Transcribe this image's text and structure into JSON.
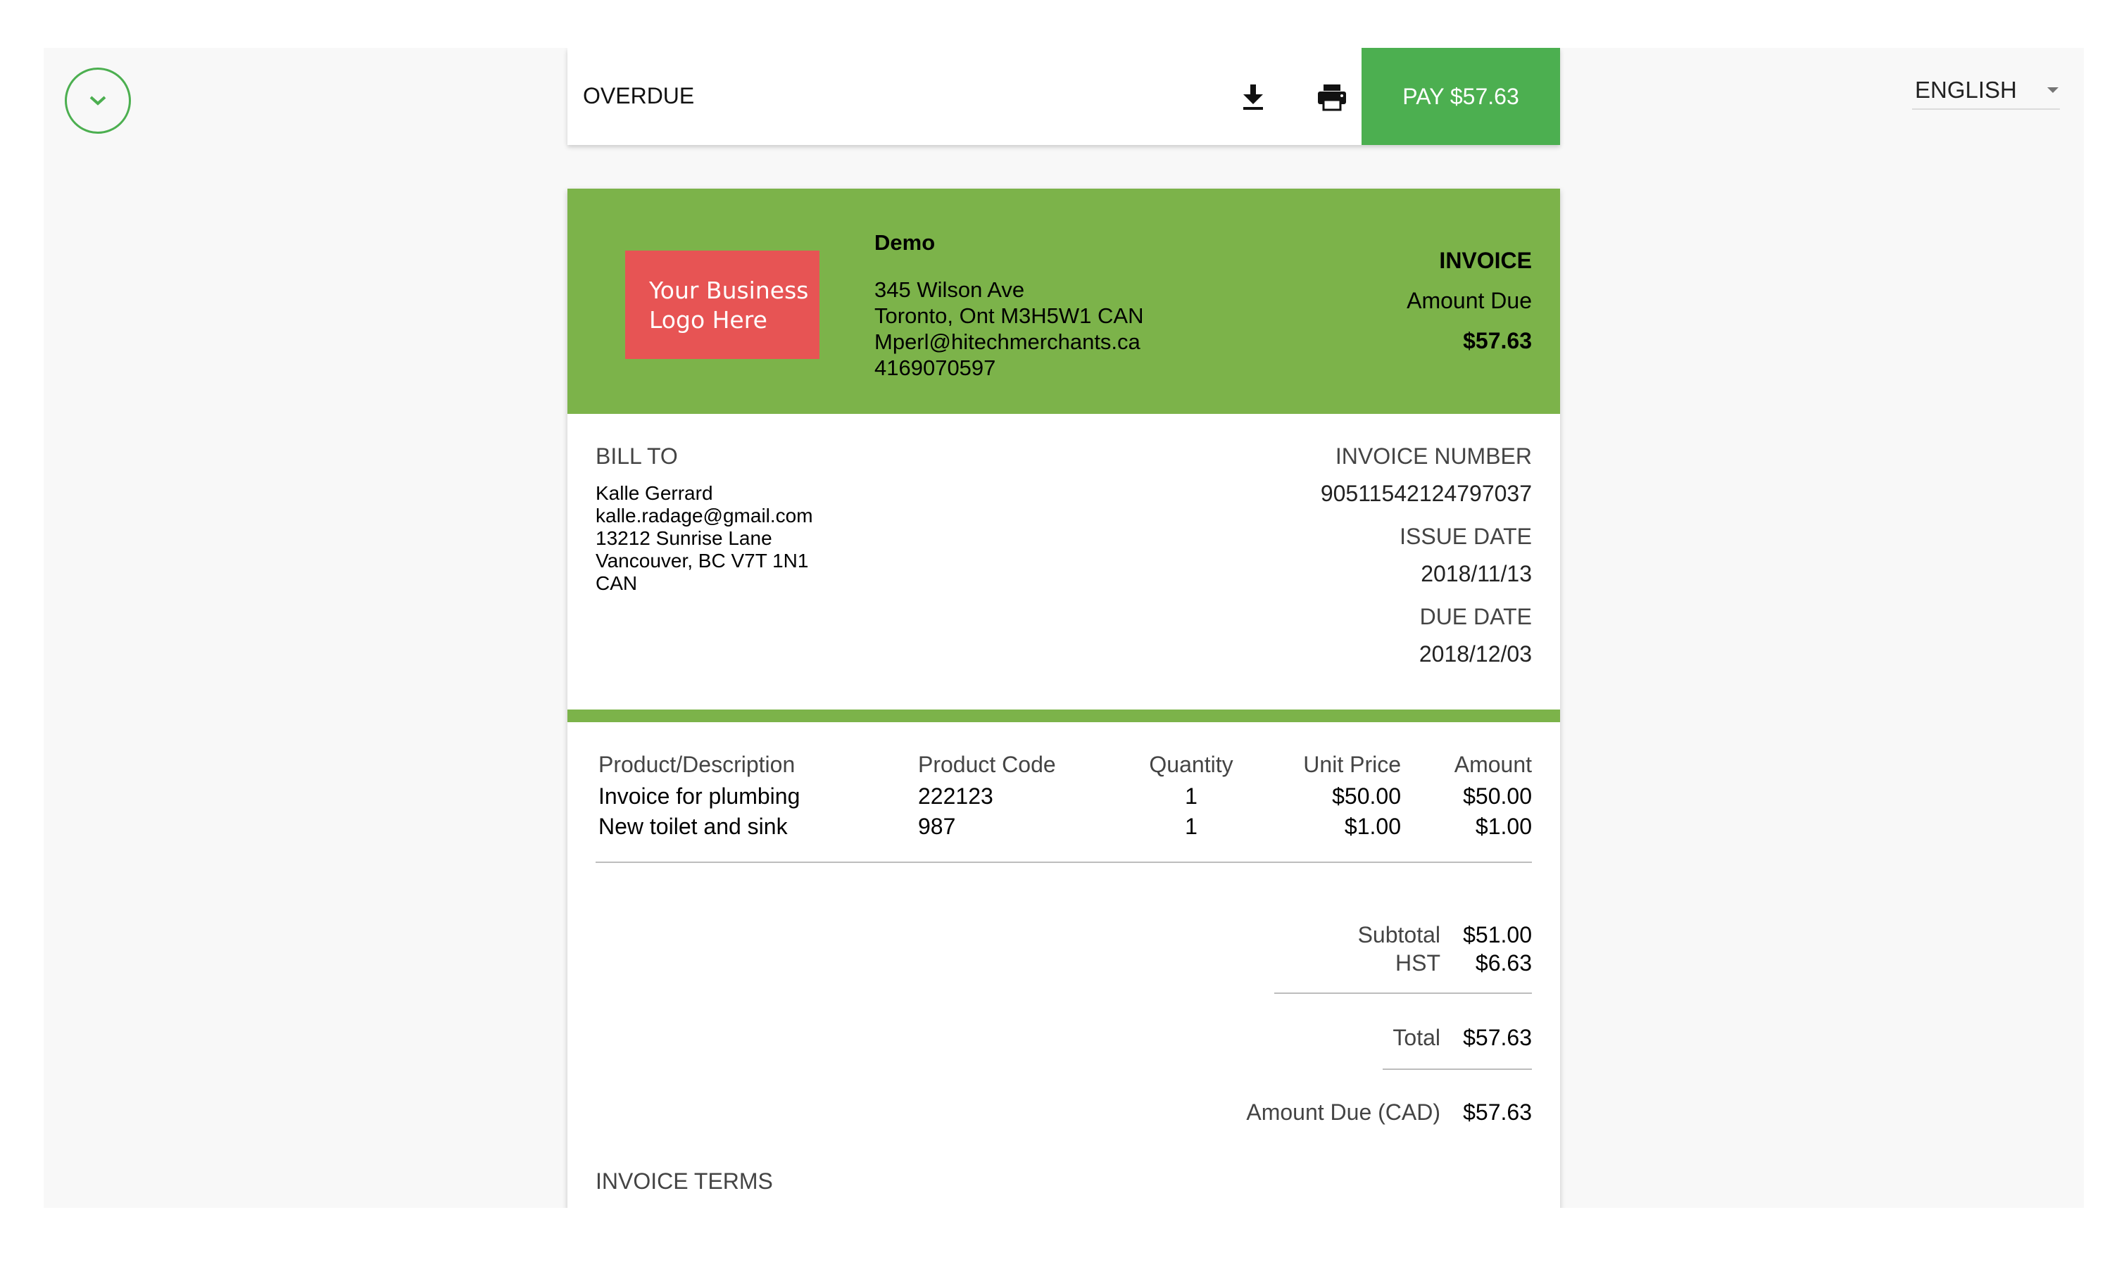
{
  "toolbar": {
    "status": "OVERDUE",
    "download_icon": "download-icon",
    "print_icon": "print-icon",
    "pay_label": "PAY $57.63"
  },
  "language": {
    "selected": "ENGLISH"
  },
  "colors": {
    "accent": "#4caf50",
    "header": "#7cb34a",
    "logo": "#e75454"
  },
  "invoice": {
    "logo_line1": "Your Business",
    "logo_line2": "Logo Here",
    "business": {
      "name": "Demo",
      "address1": "345 Wilson Ave",
      "address2": "Toronto, Ont M3H5W1 CAN",
      "email": "Mperl@hitechmerchants.ca",
      "phone": "4169070597"
    },
    "title": "INVOICE",
    "amount_due_label": "Amount Due",
    "amount_due": "$57.63",
    "bill_to": {
      "label": "BILL TO",
      "name": "Kalle Gerrard",
      "email": "kalle.radage@gmail.com",
      "street": "13212 Sunrise Lane",
      "city": "Vancouver, BC V7T 1N1",
      "country": "CAN"
    },
    "number_label": "INVOICE NUMBER",
    "number": "90511542124797037",
    "issue_label": "ISSUE DATE",
    "issue_date": "2018/11/13",
    "due_label": "DUE DATE",
    "due_date": "2018/12/03",
    "columns": [
      "Product/Description",
      "Product Code",
      "Quantity",
      "Unit Price",
      "Amount"
    ],
    "items": [
      {
        "description": "Invoice for plumbing",
        "code": "222123",
        "quantity": "1",
        "unit_price": "$50.00",
        "amount": "$50.00"
      },
      {
        "description": "New toilet and sink",
        "code": "987",
        "quantity": "1",
        "unit_price": "$1.00",
        "amount": "$1.00"
      }
    ],
    "subtotal_label": "Subtotal",
    "subtotal": "$51.00",
    "tax_label": "HST",
    "tax": "$6.63",
    "total_label": "Total",
    "total": "$57.63",
    "amount_due_cad_label": "Amount Due (CAD)",
    "amount_due_cad": "$57.63",
    "terms_label": "INVOICE TERMS"
  }
}
